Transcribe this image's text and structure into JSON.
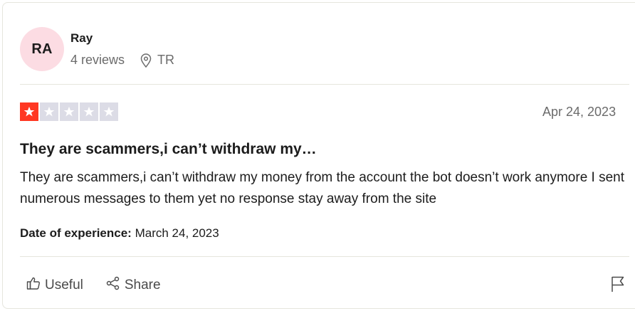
{
  "reviewer": {
    "initials": "RA",
    "name": "Ray",
    "reviews_count": "4 reviews",
    "country": "TR"
  },
  "review": {
    "rating": 1,
    "max_rating": 5,
    "date": "Apr 24, 2023",
    "title": "They are scammers,i can’t withdraw my…",
    "body": "They are scammers,i can’t withdraw my money from the account the bot doesn’t work anymore I sent numerous messages to them yet no response stay away from the site",
    "experience_label": "Date of experience:",
    "experience_date": "March 24, 2023"
  },
  "actions": {
    "useful_label": "Useful",
    "share_label": "Share"
  },
  "colors": {
    "star_filled": "#ff3722",
    "star_empty": "#dcdce6",
    "avatar_bg": "#fcdce3"
  },
  "icons": [
    "map-pin-icon",
    "thumbs-up-icon",
    "share-icon",
    "flag-icon",
    "star-icon"
  ]
}
